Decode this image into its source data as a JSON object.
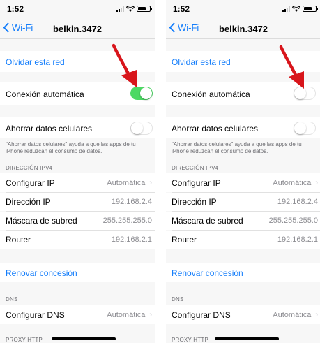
{
  "left": {
    "status": {
      "time": "1:52"
    },
    "nav": {
      "back": "Wi-Fi",
      "title": "belkin.3472"
    },
    "forget": "Olvidar esta red",
    "auto_join": {
      "label": "Conexión automática",
      "state": "on"
    },
    "low_data": {
      "label": "Ahorrar datos celulares",
      "state": "off"
    },
    "low_data_note": "\"Ahorrar datos celulares\" ayuda a que las apps de tu iPhone reduzcan el consumo de datos.",
    "ipv4_header": "DIRECCIÓN IPV4",
    "configure_ip": {
      "label": "Configurar IP",
      "value": "Automática"
    },
    "ip_address": {
      "label": "Dirección IP",
      "value": "192.168.2.4"
    },
    "subnet": {
      "label": "Máscara de subred",
      "value": "255.255.255.0"
    },
    "router": {
      "label": "Router",
      "value": "192.168.2.1"
    },
    "renew": "Renovar concesión",
    "dns_header": "DNS",
    "configure_dns": {
      "label": "Configurar DNS",
      "value": "Automática"
    },
    "proxy_header": "PROXY HTTP"
  },
  "right": {
    "status": {
      "time": "1:52"
    },
    "nav": {
      "back": "Wi-Fi",
      "title": "belkin.3472"
    },
    "forget": "Olvidar esta red",
    "auto_join": {
      "label": "Conexión automática",
      "state": "off"
    },
    "low_data": {
      "label": "Ahorrar datos celulares",
      "state": "off"
    },
    "low_data_note": "\"Ahorrar datos celulares\" ayuda a que las apps de tu iPhone reduzcan el consumo de datos.",
    "ipv4_header": "DIRECCIÓN IPV4",
    "configure_ip": {
      "label": "Configurar IP",
      "value": "Automática"
    },
    "ip_address": {
      "label": "Dirección IP",
      "value": "192.168.2.4"
    },
    "subnet": {
      "label": "Máscara de subred",
      "value": "255.255.255.0"
    },
    "router": {
      "label": "Router",
      "value": "192.168.2.1"
    },
    "renew": "Renovar concesión",
    "dns_header": "DNS",
    "configure_dns": {
      "label": "Configurar DNS",
      "value": "Automática"
    },
    "proxy_header": "PROXY HTTP"
  },
  "colors": {
    "accent": "#157efb",
    "toggle_on": "#4cd964",
    "arrow": "#d8151b"
  }
}
